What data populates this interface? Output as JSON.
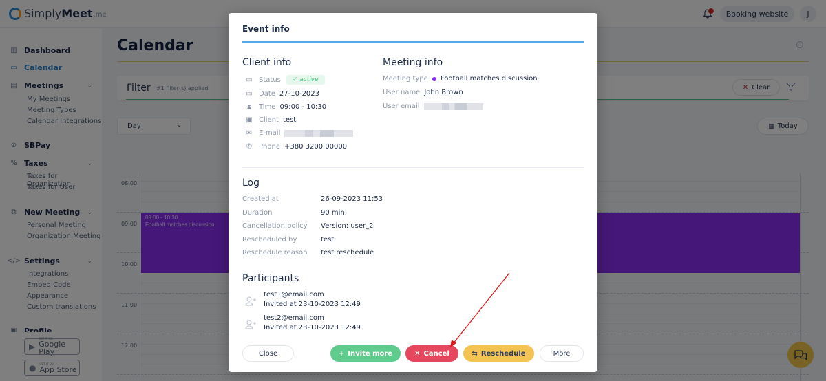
{
  "app": {
    "logo_prefix": "Simply",
    "logo_bold": "Meet",
    "logo_suffix": ".me"
  },
  "header": {
    "booking_label": "Booking website",
    "avatar_initial": "J",
    "notification_count": "1"
  },
  "sidebar": {
    "items": [
      {
        "label": "Dashboard",
        "icon": "bar-chart-icon"
      },
      {
        "label": "Calendar",
        "icon": "calendar-icon",
        "active": true
      },
      {
        "label": "Meetings",
        "icon": "meetings-icon",
        "sub": [
          "My Meetings",
          "Meeting Types",
          "Calendar Integrations"
        ]
      },
      {
        "label": "SBPay",
        "icon": "link-icon"
      },
      {
        "label": "Taxes",
        "icon": "percent-icon",
        "sub": [
          "Taxes for Organization",
          "Taxes for User"
        ]
      },
      {
        "label": "New Meeting",
        "icon": "new-meeting-icon",
        "sub": [
          "Personal Meeting",
          "Organization Meeting"
        ]
      },
      {
        "label": "Settings",
        "icon": "code-icon",
        "sub": [
          "Integrations",
          "Embed Code",
          "Appearance",
          "Custom translations"
        ]
      },
      {
        "label": "Profile",
        "icon": "profile-icon"
      }
    ],
    "stores": [
      {
        "small": "GET IT ON",
        "big": "Google Play"
      },
      {
        "small": "GET IT ON",
        "big": "App Store"
      }
    ]
  },
  "main": {
    "title": "Calendar",
    "filter": {
      "title": "Filter",
      "count": "#1 filter(s) applied",
      "clear_label": "Clear"
    },
    "view_select": "Day",
    "today_label": "Today",
    "hours": [
      "08:00",
      "09:00",
      "10:00",
      "11:00",
      "12:00"
    ],
    "event": {
      "time": "09:00 - 10:30",
      "title": "Football matches discussion",
      "color": "#8a2ff0"
    }
  },
  "modal": {
    "title": "Event info",
    "client_info": {
      "heading": "Client info",
      "status_label": "Status",
      "status_value": "active",
      "date_label": "Date",
      "date_value": "27-10-2023",
      "time_label": "Time",
      "time_value": "09:00 - 10:30",
      "client_label": "Client",
      "client_value": "test",
      "email_label": "E-mail",
      "phone_label": "Phone",
      "phone_value": "+380 3200 00000"
    },
    "meeting_info": {
      "heading": "Meeting info",
      "type_label": "Meeting type",
      "type_value": "Football matches discussion",
      "user_name_label": "User name",
      "user_name_value": "John Brown",
      "user_email_label": "User email"
    },
    "log": {
      "heading": "Log",
      "rows": [
        {
          "label": "Created at",
          "value": "26-09-2023 11:53"
        },
        {
          "label": "Duration",
          "value": "90 min."
        },
        {
          "label": "Cancellation policy",
          "value": "Version: user_2"
        },
        {
          "label": "Rescheduled by",
          "value": "test"
        },
        {
          "label": "Reschedule reason",
          "value": "test reschedule"
        }
      ]
    },
    "participants": {
      "heading": "Participants",
      "list": [
        {
          "email": "test1@email.com",
          "invited": "Invited at 23-10-2023 12:49"
        },
        {
          "email": "test2@email.com",
          "invited": "Invited at 23-10-2023 12:49"
        }
      ]
    },
    "buttons": {
      "close": "Close",
      "invite": "Invite more",
      "cancel": "Cancel",
      "reschedule": "Reschedule",
      "more": "More"
    }
  }
}
